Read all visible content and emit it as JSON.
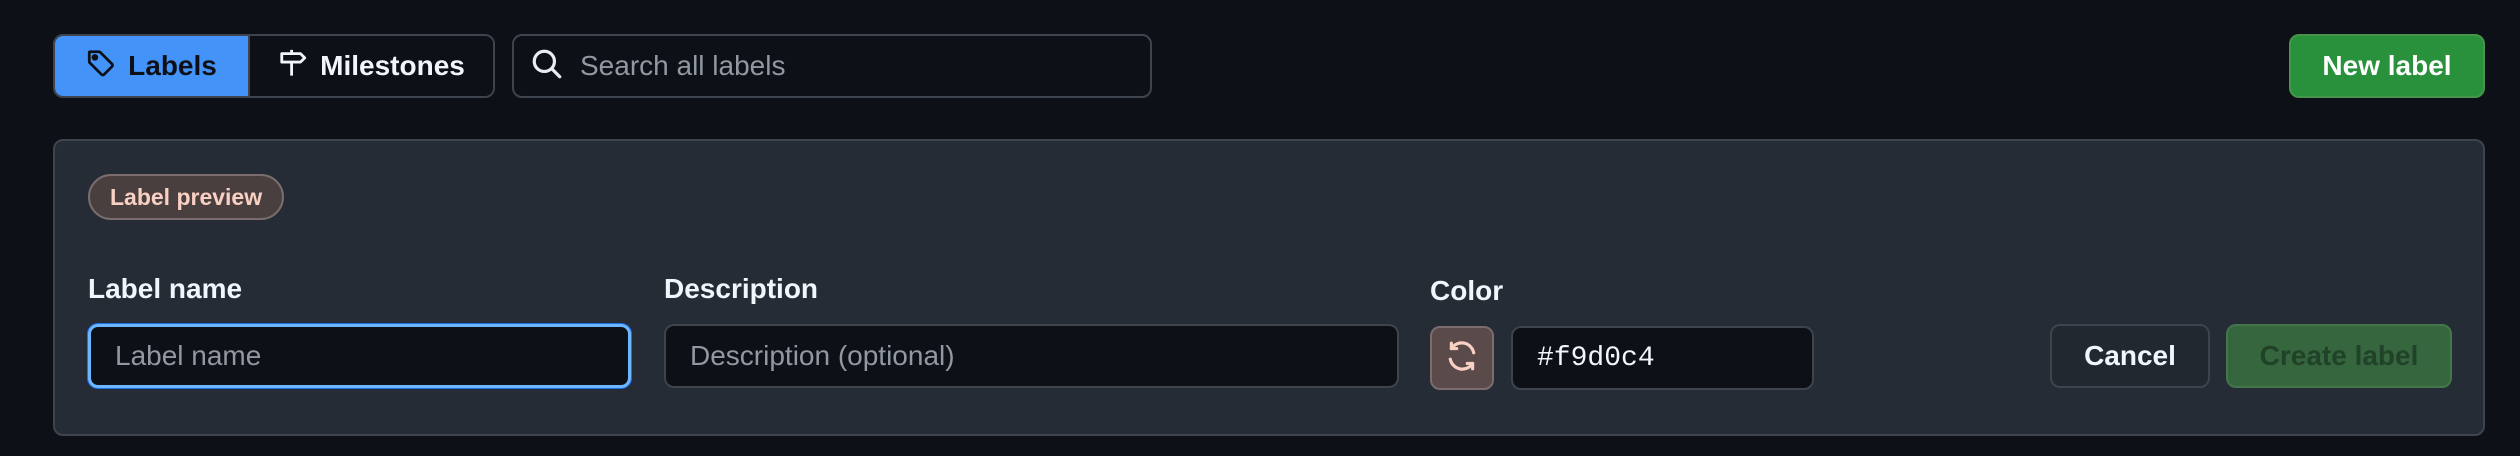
{
  "toolbar": {
    "labels_tab": "Labels",
    "milestones_tab": "Milestones",
    "search_placeholder": "Search all labels",
    "search_value": "",
    "new_label_button": "New label"
  },
  "form": {
    "preview_badge": "Label preview",
    "name_label": "Label name",
    "name_placeholder": "Label name",
    "name_value": "",
    "description_label": "Description",
    "description_placeholder": "Description (optional)",
    "description_value": "",
    "color_label": "Color",
    "color_value": "#f9d0c4",
    "cancel_button": "Cancel",
    "create_button": "Create label"
  },
  "icons": {
    "labels_tab": "tag-icon",
    "milestones_tab": "milestone-signpost-icon",
    "search": "search-icon",
    "color_refresh": "sync-icon"
  },
  "colors": {
    "background": "#0d1117",
    "panel": "#262c36",
    "accent_blue": "#4493f8",
    "primary_green": "#29903b",
    "preview_label_text": "#f9d0c4"
  }
}
